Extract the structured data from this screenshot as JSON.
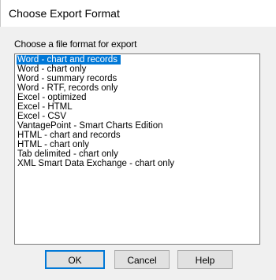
{
  "dialog": {
    "title": "Choose Export Format",
    "prompt": "Choose a file format for export",
    "list": {
      "selected_index": 0,
      "items": [
        "Word - chart and records",
        "Word - chart only",
        "Word - summary records",
        "Word - RTF, records only",
        "Excel - optimized",
        "Excel - HTML",
        "Excel - CSV",
        "VantagePoint - Smart Charts Edition",
        "HTML - chart and records",
        "HTML - chart only",
        "Tab delimited - chart only",
        "XML Smart Data Exchange - chart only"
      ]
    },
    "buttons": {
      "ok": "OK",
      "cancel": "Cancel",
      "help": "Help"
    },
    "colors": {
      "selection": "#0078d7",
      "background": "#f0f0f0"
    }
  }
}
